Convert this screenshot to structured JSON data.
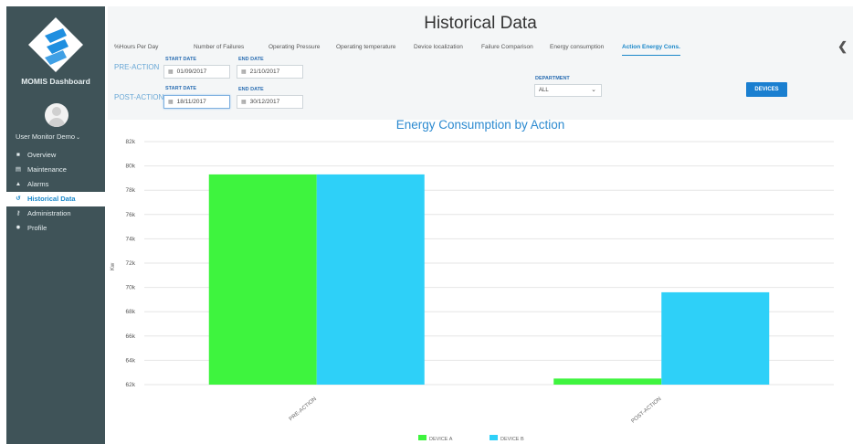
{
  "sidebar": {
    "app_title": "MOMIS Dashboard",
    "user_name": "User Monitor Demo",
    "user_caret": "⌄",
    "items": [
      {
        "label": "Overview",
        "icon": "home-icon",
        "glyph": "■"
      },
      {
        "label": "Maintenance",
        "icon": "document-icon",
        "glyph": "▤"
      },
      {
        "label": "Alarms",
        "icon": "warning-icon",
        "glyph": "▲"
      },
      {
        "label": "Historical Data",
        "icon": "history-icon",
        "glyph": "↺"
      },
      {
        "label": "Administration",
        "icon": "key-icon",
        "glyph": "⚷"
      },
      {
        "label": "Profile",
        "icon": "gear-icon",
        "glyph": "✹"
      }
    ],
    "active_index": 3
  },
  "header": {
    "title": "Historical Data",
    "back_arrow": "❮"
  },
  "tabs": [
    "%Hours Per Day",
    "Number of Failures",
    "Operating Pressure",
    "Operating temperature",
    "Device localization",
    "Failure Comparison",
    "Energy consumption",
    "Action Energy Cons."
  ],
  "active_tab": 7,
  "filters": {
    "pre_action_label": "PRE-ACTION",
    "post_action_label": "POST-ACTION",
    "start_date_label": "START DATE",
    "end_date_label": "END DATE",
    "pre_start": "01/09/2017",
    "pre_end": "21/10/2017",
    "post_start": "18/11/2017",
    "post_end": "30/12/2017",
    "department_label": "DEPARTMENT",
    "department_value": "ALL",
    "devices_button": "DEVICES",
    "calendar_glyph": "▦"
  },
  "colors": {
    "device_a": "#3ef43e",
    "device_b": "#2ed0f8",
    "accent": "#1a87c9",
    "sidebar_bg": "#3f5358"
  },
  "chart_data": {
    "type": "bar",
    "title": "Energy Consumption by Action",
    "ylabel": "Kw",
    "categories": [
      "PRE-ACTION",
      "POST-ACTION"
    ],
    "series": [
      {
        "name": "DEVICE A",
        "values": [
          79300,
          62500
        ]
      },
      {
        "name": "DEVICE B",
        "values": [
          79300,
          69600
        ]
      }
    ],
    "ylim": [
      62000,
      82000
    ],
    "yticks": [
      62000,
      64000,
      66000,
      68000,
      70000,
      72000,
      74000,
      76000,
      78000,
      80000,
      82000
    ],
    "ytick_labels": [
      "62k",
      "64k",
      "66k",
      "68k",
      "70k",
      "72k",
      "74k",
      "76k",
      "78k",
      "80k",
      "82k"
    ],
    "grid": true,
    "legend_position": "bottom"
  }
}
